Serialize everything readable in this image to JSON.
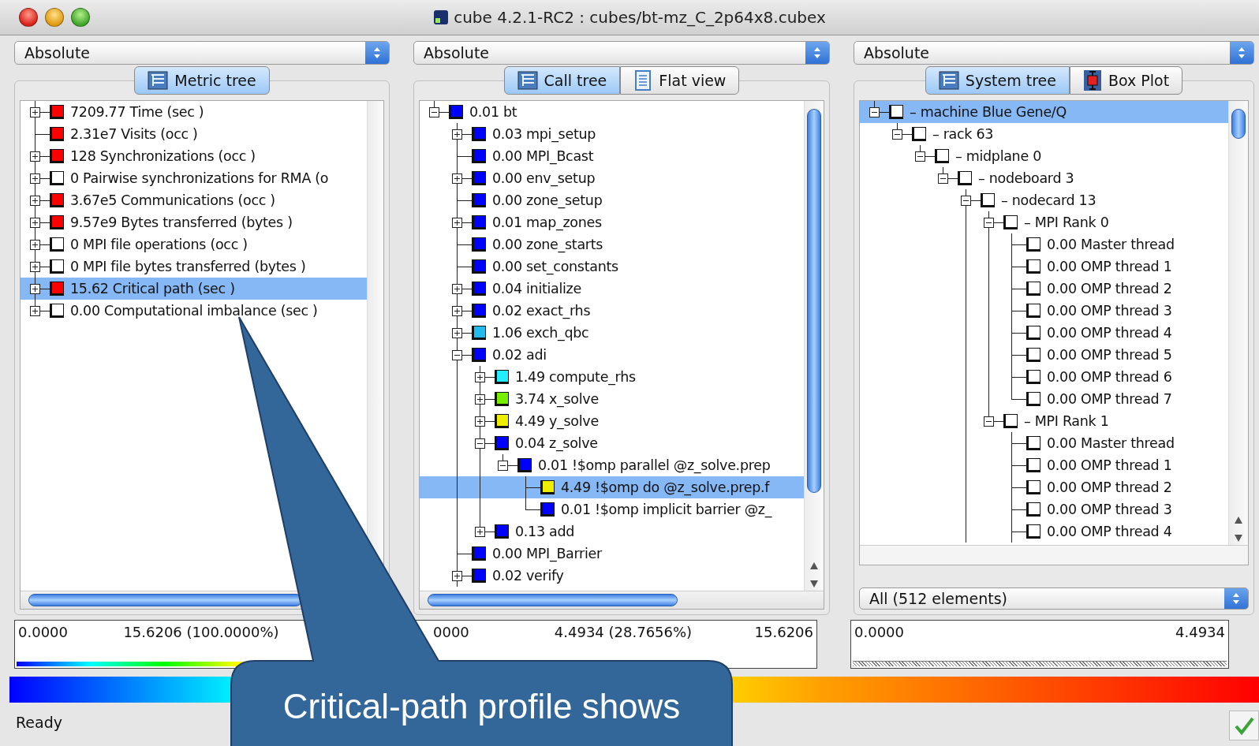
{
  "window": {
    "title": "cube 4.2.1-RC2 : cubes/bt-mz_C_2p64x8.cubex"
  },
  "panels": [
    {
      "mode": "Absolute",
      "tabs": [
        {
          "label": "Metric tree",
          "kind": "tree",
          "selected": true
        }
      ],
      "tree": [
        {
          "label": "7209.77 Time (sec )",
          "color": "#ff0000",
          "expanded": false,
          "selected": false
        },
        {
          "label": "2.31e7 Visits (occ )",
          "color": "#ff0000",
          "selected": false
        },
        {
          "label": "128 Synchronizations (occ )",
          "color": "#ff0000",
          "expanded": false,
          "selected": false
        },
        {
          "label": "0 Pairwise synchronizations for RMA (o",
          "color": "#ffffff",
          "expanded": false,
          "selected": false
        },
        {
          "label": "3.67e5 Communications (occ )",
          "color": "#ff0000",
          "expanded": false,
          "selected": false
        },
        {
          "label": "9.57e9 Bytes transferred (bytes )",
          "color": "#ff0000",
          "expanded": false,
          "selected": false
        },
        {
          "label": "0 MPI file operations (occ )",
          "color": "#ffffff",
          "expanded": false,
          "selected": false
        },
        {
          "label": "0 MPI file bytes transferred (bytes )",
          "color": "#ffffff",
          "expanded": false,
          "selected": false
        },
        {
          "label": "15.62 Critical path (sec )",
          "color": "#ff0000",
          "expanded": false,
          "selected": true
        },
        {
          "label": "0.00 Computational imbalance (sec )",
          "color": "#ffffff",
          "expanded": false,
          "selected": false
        }
      ],
      "range": {
        "min": "0.0000",
        "mid": "15.6206 (100.0000%)",
        "kind": "gradient"
      }
    },
    {
      "mode": "Absolute",
      "tabs": [
        {
          "label": "Call tree",
          "kind": "tree",
          "selected": true
        },
        {
          "label": "Flat view",
          "kind": "list",
          "selected": false
        }
      ],
      "tree": [
        {
          "label": "0.01 bt",
          "color": "#0000ff",
          "expanded": true,
          "selected": false,
          "children": [
            {
              "label": "0.03 mpi_setup",
              "color": "#0000ff",
              "expanded": false,
              "selected": false
            },
            {
              "label": "0.00 MPI_Bcast",
              "color": "#0000ff",
              "selected": false
            },
            {
              "label": "0.00 env_setup",
              "color": "#0000ff",
              "expanded": false,
              "selected": false
            },
            {
              "label": "0.00 zone_setup",
              "color": "#0000ff",
              "selected": false
            },
            {
              "label": "0.01 map_zones",
              "color": "#0000ff",
              "expanded": false,
              "selected": false
            },
            {
              "label": "0.00 zone_starts",
              "color": "#0000ff",
              "selected": false
            },
            {
              "label": "0.00 set_constants",
              "color": "#0000ff",
              "selected": false
            },
            {
              "label": "0.04 initialize",
              "color": "#0000ff",
              "expanded": false,
              "selected": false
            },
            {
              "label": "0.02 exact_rhs",
              "color": "#0000ff",
              "expanded": false,
              "selected": false
            },
            {
              "label": "1.06 exch_qbc",
              "color": "#22bbee",
              "expanded": false,
              "selected": false
            },
            {
              "label": "0.02 adi",
              "color": "#0000ff",
              "expanded": true,
              "selected": false,
              "children": [
                {
                  "label": "1.49 compute_rhs",
                  "color": "#22eeff",
                  "expanded": false,
                  "selected": false
                },
                {
                  "label": "3.74 x_solve",
                  "color": "#77ee00",
                  "expanded": false,
                  "selected": false
                },
                {
                  "label": "4.49 y_solve",
                  "color": "#eeee00",
                  "expanded": false,
                  "selected": false
                },
                {
                  "label": "0.04 z_solve",
                  "color": "#0000ff",
                  "expanded": true,
                  "selected": false,
                  "children": [
                    {
                      "label": "0.01 !$omp parallel @z_solve.prep",
                      "color": "#0000ff",
                      "expanded": true,
                      "selected": false,
                      "children": [
                        {
                          "label": "4.49 !$omp do @z_solve.prep.f",
                          "color": "#eeee00",
                          "selected": true
                        },
                        {
                          "label": "0.01 !$omp implicit barrier @z_",
                          "color": "#0000ff",
                          "selected": false
                        }
                      ]
                    }
                  ]
                },
                {
                  "label": "0.13 add",
                  "color": "#0000ff",
                  "expanded": false,
                  "selected": false
                }
              ]
            },
            {
              "label": "0.00 MPI_Barrier",
              "color": "#0000ff",
              "selected": false
            },
            {
              "label": "0.02 verify",
              "color": "#0000ff",
              "expanded": false,
              "selected": false,
              "continues": true
            }
          ]
        }
      ],
      "range": {
        "min": "0000",
        "mid": "4.4934 (28.7656%)",
        "max": "15.6206"
      }
    },
    {
      "mode": "Absolute",
      "tabs": [
        {
          "label": "System tree",
          "kind": "tree",
          "selected": true
        },
        {
          "label": "Box Plot",
          "kind": "plot",
          "selected": false
        }
      ],
      "tree": [
        {
          "label": "– machine Blue Gene/Q",
          "expanded": true,
          "selected": true,
          "children": [
            {
              "label": "– rack 63",
              "expanded": true,
              "selected": false,
              "children": [
                {
                  "label": "– midplane 0",
                  "expanded": true,
                  "selected": false,
                  "children": [
                    {
                      "label": "– nodeboard 3",
                      "expanded": true,
                      "selected": false,
                      "children": [
                        {
                          "label": "– nodecard 13",
                          "expanded": true,
                          "selected": false,
                          "continues": true,
                          "children": [
                            {
                              "label": "– MPI Rank 0",
                              "expanded": true,
                              "selected": false,
                              "children": [
                                {
                                  "label": "0.00 Master thread",
                                  "selected": false
                                },
                                {
                                  "label": "0.00 OMP thread 1",
                                  "selected": false
                                },
                                {
                                  "label": "0.00 OMP thread 2",
                                  "selected": false
                                },
                                {
                                  "label": "0.00 OMP thread 3",
                                  "selected": false
                                },
                                {
                                  "label": "0.00 OMP thread 4",
                                  "selected": false
                                },
                                {
                                  "label": "0.00 OMP thread 5",
                                  "selected": false
                                },
                                {
                                  "label": "0.00 OMP thread 6",
                                  "selected": false
                                },
                                {
                                  "label": "0.00 OMP thread 7",
                                  "selected": false
                                }
                              ]
                            },
                            {
                              "label": "– MPI Rank 1",
                              "expanded": true,
                              "selected": false,
                              "children": [
                                {
                                  "label": "0.00 Master thread",
                                  "selected": false
                                },
                                {
                                  "label": "0.00 OMP thread 1",
                                  "selected": false
                                },
                                {
                                  "label": "0.00 OMP thread 2",
                                  "selected": false
                                },
                                {
                                  "label": "0.00 OMP thread 3",
                                  "selected": false
                                },
                                {
                                  "label": "0.00 OMP thread 4",
                                  "selected": false,
                                  "continues": true
                                }
                              ]
                            }
                          ]
                        }
                      ]
                    }
                  ]
                }
              ]
            }
          ]
        }
      ],
      "selector": "All (512 elements)",
      "range": {
        "min": "0.0000",
        "max": "4.4934",
        "kind": "hatched"
      }
    }
  ],
  "status_bar": "Ready",
  "callout": {
    "text": "Critical-path profile shows"
  }
}
